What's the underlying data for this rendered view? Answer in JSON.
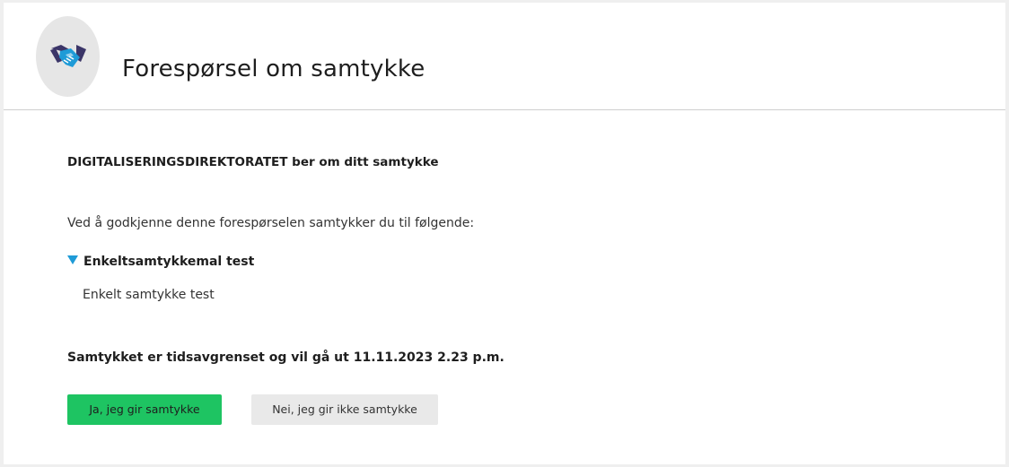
{
  "header": {
    "title": "Forespørsel om samtykke",
    "logo_icon": "handshake-icon",
    "logo_colors": {
      "circle": "#e6e6e6",
      "hand_light": "#1f9bd7",
      "hand_dark": "#3b3568"
    }
  },
  "main": {
    "requester_line": "DIGITALISERINGSDIREKTORATET ber om ditt samtykke",
    "intro_text": "Ved å godkjenne denne forespørselen samtykker du til følgende:",
    "consent_item": {
      "title": "Enkeltsamtykkemal test",
      "description": "Enkelt samtykke test",
      "expanded": true,
      "toggle_icon": "triangle-down-icon"
    },
    "expiry_text": "Samtykket er tidsavgrenset og vil gå ut 11.11.2023 2.23 p.m."
  },
  "actions": {
    "accept_label": "Ja, jeg gir samtykke",
    "decline_label": "Nei, jeg gir ikke samtykke",
    "accept_color": "#1ec462",
    "decline_color": "#e9e9e9"
  }
}
